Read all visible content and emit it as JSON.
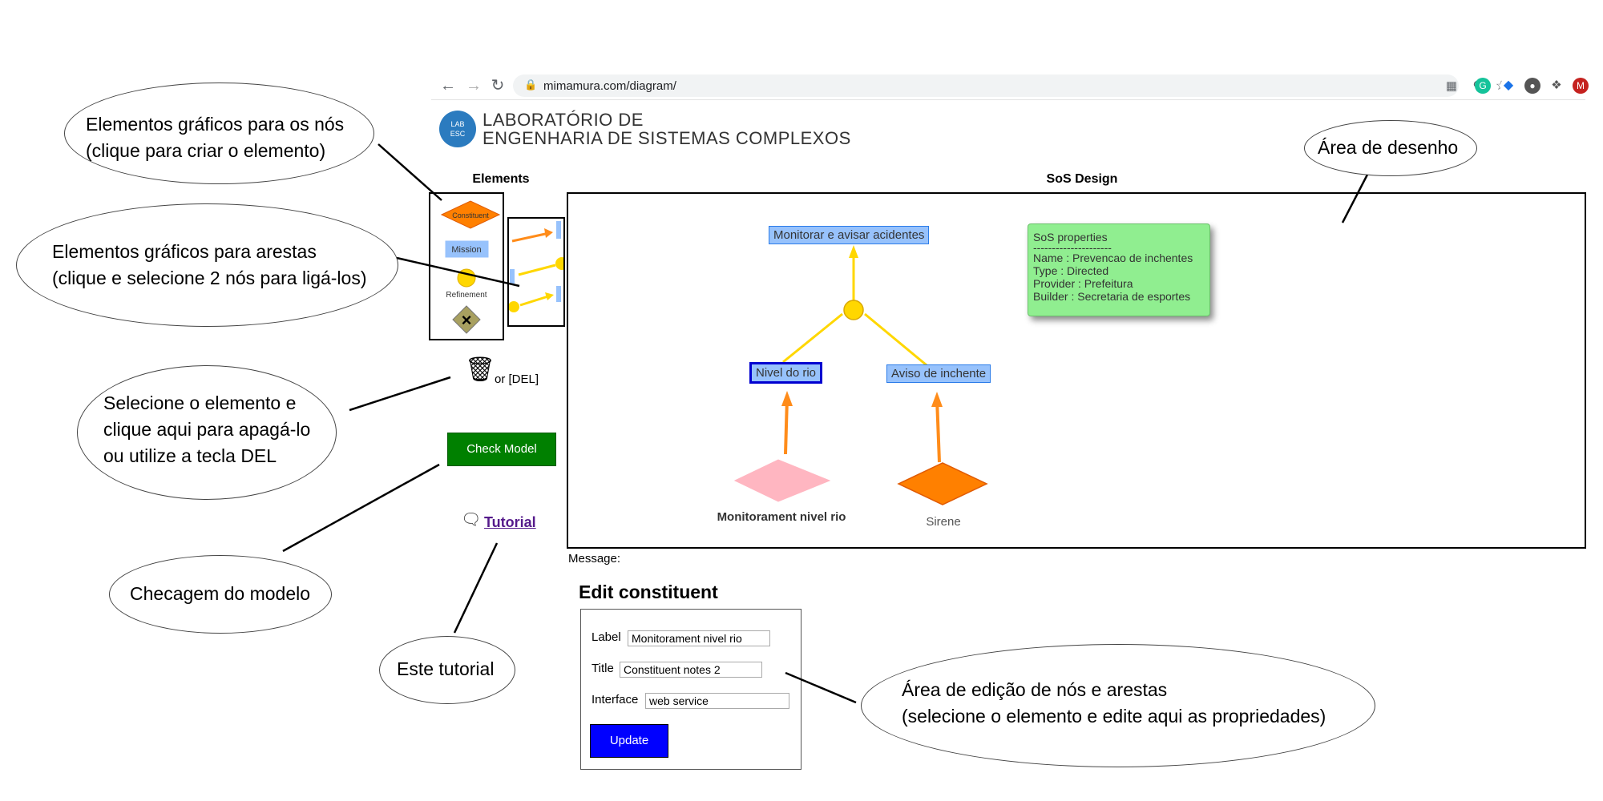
{
  "browser": {
    "url": "mimamura.com/diagram/",
    "profile_initial": "M",
    "icons": [
      "back-icon",
      "forward-icon",
      "reload-icon",
      "lock-icon",
      "qr-icon",
      "zoom-icon",
      "star-icon",
      "grammarly-icon",
      "extension-icon",
      "extension-icon",
      "puzzle-icon",
      "avatar",
      "menu-dots-icon"
    ]
  },
  "logo": {
    "badge_line1": "LAB",
    "badge_line2": "ESC",
    "line1": "LABORATÓRIO DE",
    "line2": "ENGENHARIA DE SISTEMAS COMPLEXOS"
  },
  "palette": {
    "heading": "Elements",
    "constituent_label": "Constituent",
    "mission_label": "Mission",
    "refinement_label": "Refinement",
    "delete_hint": "or [DEL]",
    "check_model": "Check Model",
    "tutorial": "Tutorial"
  },
  "canvas": {
    "heading": "SoS Design",
    "message_label": "Message:",
    "nodes": {
      "top_mission": "Monitorar e avisar acidentes",
      "left_mission": "Nivel do rio",
      "right_mission": "Aviso de inchente",
      "left_constituent": "Monitorament nivel rio",
      "right_constituent": "Sirene"
    },
    "properties": {
      "title": "SoS properties",
      "separator": "---------------------",
      "name": "Name : Prevencao de inchentes",
      "type": "Type : Directed",
      "provider": "Provider : Prefeitura",
      "builder": "Builder : Secretaria de esportes"
    }
  },
  "edit_panel": {
    "heading": "Edit constituent",
    "label_label": "Label",
    "label_value": "Monitorament nivel rio",
    "title_label": "Title",
    "title_value": "Constituent notes 2",
    "interface_label": "Interface",
    "interface_value": "web service",
    "update_button": "Update"
  },
  "callouts": {
    "nodes_line1": "Elementos gráficos para os nós",
    "nodes_line2": "(clique para criar o elemento)",
    "edges_line1": "Elementos gráficos para arestas",
    "edges_line2": "(clique e selecione 2 nós para ligá-los)",
    "delete_line1": "Selecione o elemento e",
    "delete_line2": "clique aqui para apagá-lo",
    "delete_line3": "ou utilize a tecla DEL",
    "check": "Checagem do modelo",
    "tutorial": "Este tutorial",
    "draw_area": "Área de desenho",
    "edit_line1": "Área de edição de nós e arestas",
    "edit_line2": "(selecione o elemento e edite aqui as propriedades)"
  },
  "colors": {
    "constituent": "#ff8000",
    "mission": "#97c2fc",
    "refinement": "#ffd700",
    "edge_orange": "#ff8c1a",
    "edge_yellow": "#ffd700",
    "constituent_selected": "#ffb6c1",
    "check_button": "#008000",
    "update_button": "#0000ff",
    "properties_bg": "#90ee90"
  }
}
